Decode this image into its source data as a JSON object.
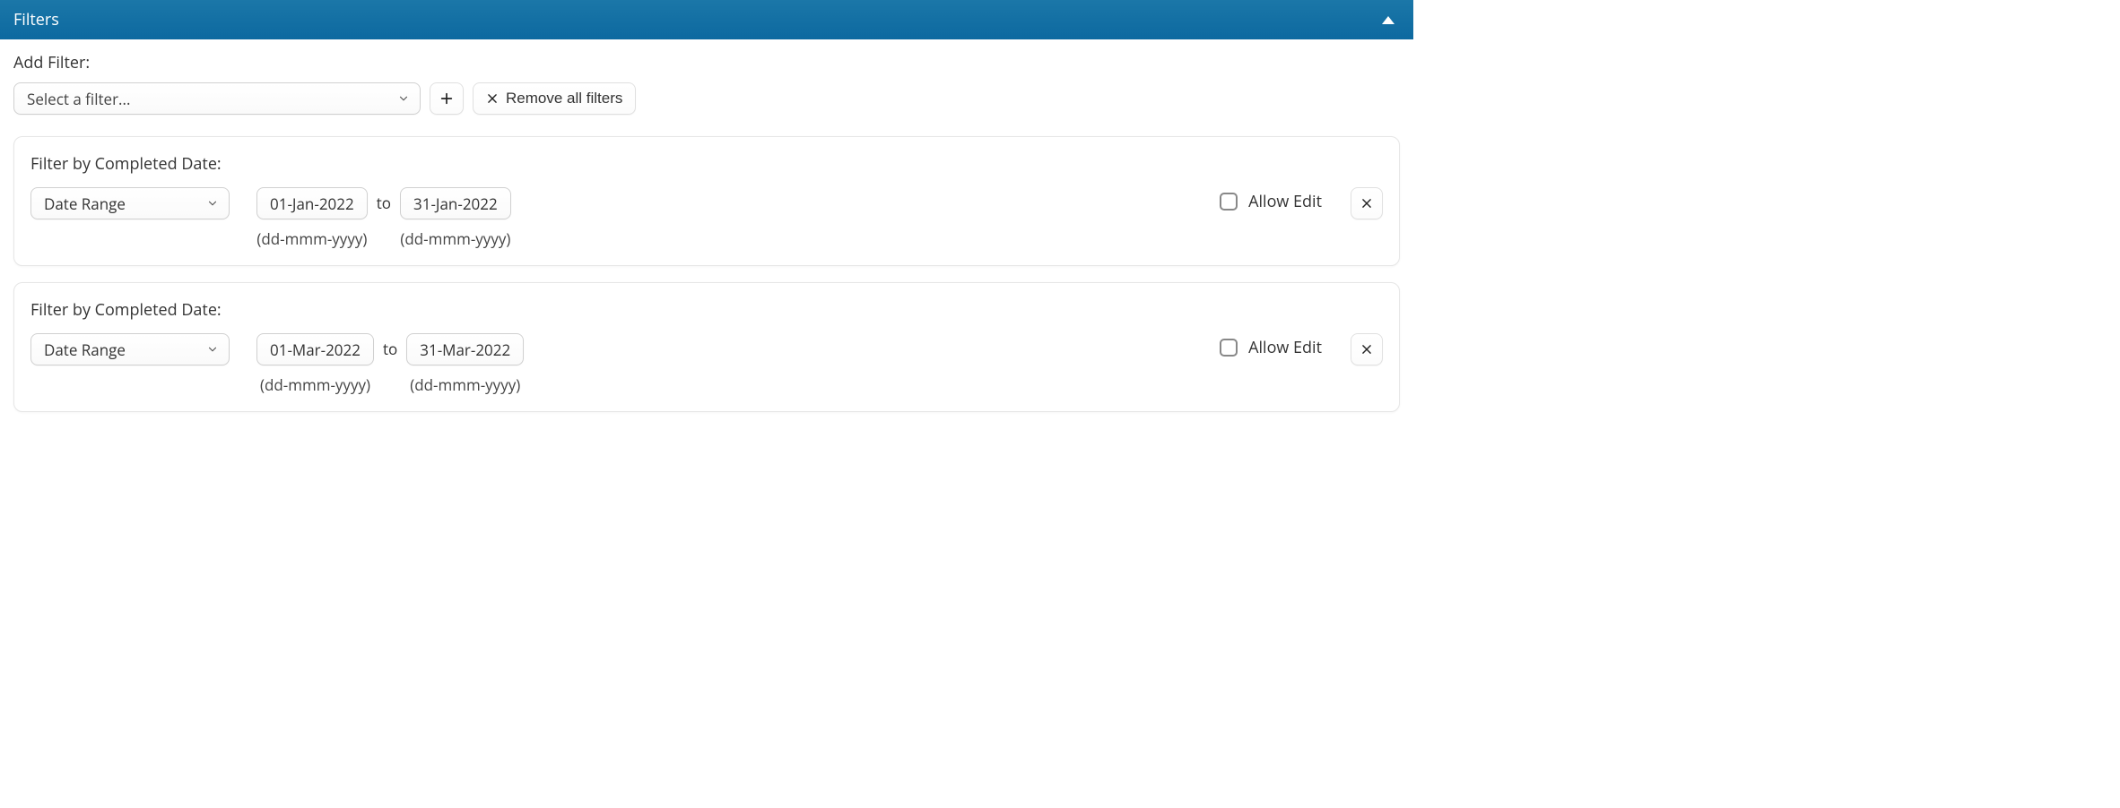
{
  "header": {
    "title": "Filters"
  },
  "addFilter": {
    "label": "Add Filter:",
    "placeholder": "Select a filter...",
    "removeAllLabel": "Remove all filters"
  },
  "common": {
    "toLabel": "to",
    "dateHint": "(dd-mmm-yyyy)",
    "allowEditLabel": "Allow Edit"
  },
  "filters": [
    {
      "title": "Filter by Completed Date:",
      "type": "Date Range",
      "from": "01-Jan-2022",
      "to": "31-Jan-2022",
      "allowEdit": false
    },
    {
      "title": "Filter by Completed Date:",
      "type": "Date Range",
      "from": "01-Mar-2022",
      "to": "31-Mar-2022",
      "allowEdit": false
    }
  ]
}
